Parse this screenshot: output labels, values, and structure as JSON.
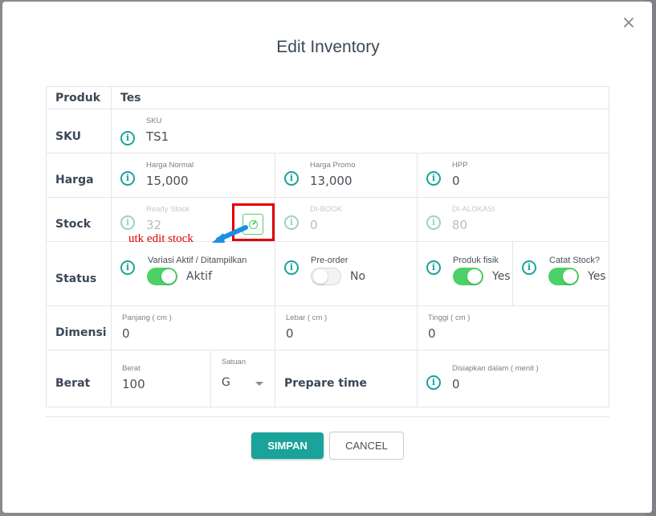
{
  "dialog": {
    "title": "Edit Inventory",
    "close_symbol": "×"
  },
  "produk": {
    "label": "Produk",
    "value": "Tes"
  },
  "sku": {
    "label": "SKU",
    "field_label": "SKU",
    "value": "TS1"
  },
  "harga": {
    "label": "Harga",
    "normal_label": "Harga Normal",
    "normal_value": "15,000",
    "promo_label": "Harga Promo",
    "promo_value": "13,000",
    "hpp_label": "HPP",
    "hpp_value": "0"
  },
  "stock": {
    "label": "Stock",
    "ready_label": "Ready Stock",
    "ready_value": "32",
    "booked_label": "DI-BOOK",
    "booked_value": "0",
    "alokasi_label": "DI-ALOKASI",
    "alokasi_value": "80",
    "annotation": "utk edit stock"
  },
  "status": {
    "label": "Status",
    "variasi_label": "Variasi Aktif / Ditampilkan",
    "variasi_value": "Aktif",
    "preorder_label": "Pre-order",
    "preorder_value": "No",
    "fisik_label": "Produk fisik",
    "fisik_value": "Yes",
    "catat_label": "Catat Stock?",
    "catat_value": "Yes"
  },
  "dimensi": {
    "label": "Dimensi",
    "panjang_label": "Panjang ( cm )",
    "panjang_value": "0",
    "lebar_label": "Lebar ( cm )",
    "lebar_value": "0",
    "tinggi_label": "Tinggi ( cm )",
    "tinggi_value": "0"
  },
  "berat": {
    "label": "Berat",
    "berat_label": "Berat",
    "berat_value": "100",
    "satuan_label": "Satuan",
    "satuan_value": "G",
    "prepare_label": "Prepare time",
    "disiapkan_label": "Disiapkan dalam ( menit )",
    "disiapkan_value": "0"
  },
  "info_symbol": "i",
  "actions": {
    "save": "SIMPAN",
    "cancel": "CANCEL"
  },
  "colors": {
    "accent": "#1aa39a",
    "toggle_on": "#4cd167",
    "annotation": "#e00000"
  }
}
